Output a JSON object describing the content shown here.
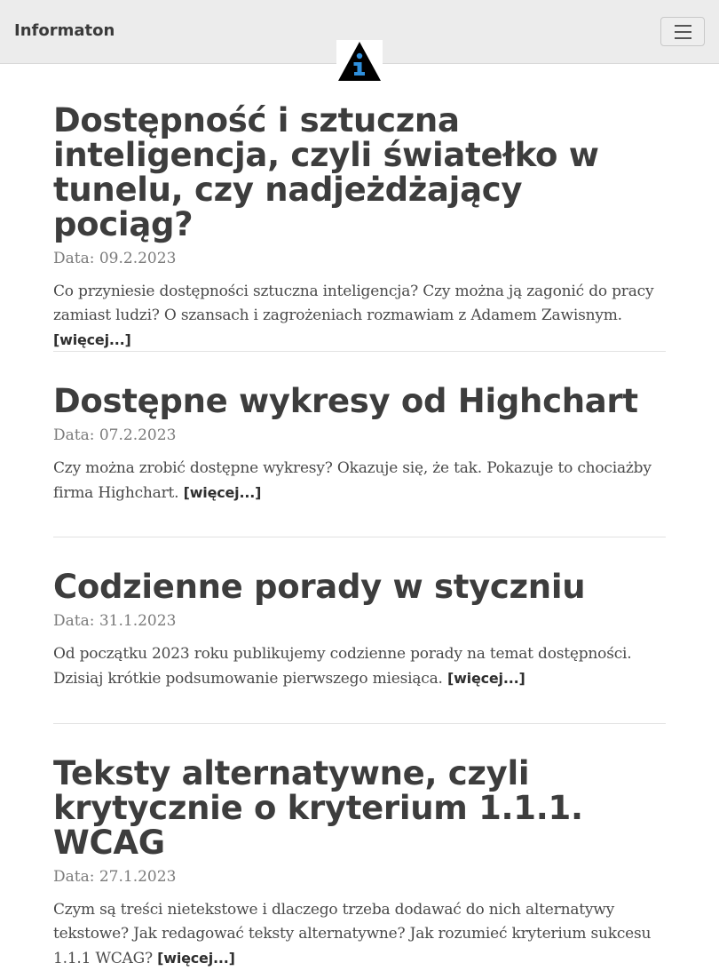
{
  "navbar": {
    "brand": "Informaton",
    "toggler_icon": "hamburger-icon",
    "logo_icon": "information-warning-triangle-icon"
  },
  "articles": [
    {
      "title": "Dostępność i sztuczna inteligencja, czyli światełko w tunelu, czy nadjeżdżający pociąg?",
      "date": "Data: 09.2.2023",
      "excerpt": "Co przyniesie dostępności sztuczna inteligencja? Czy można ją zagonić do pracy zamiast ludzi? O szansach i zagrożeniach rozmawiam z Adamem Zawisnym.",
      "more": "[więcej...]"
    },
    {
      "title": "Dostępne wykresy od Highchart",
      "date": "Data: 07.2.2023",
      "excerpt": "Czy można zrobić dostępne wykresy? Okazuje się, że tak. Pokazuje to chociażby firma Highchart.",
      "more": "[więcej...]"
    },
    {
      "title": "Codzienne porady w styczniu",
      "date": "Data: 31.1.2023",
      "excerpt": "Od początku 2023 roku publikujemy codzienne porady na temat dostępności. Dzisiaj krótkie podsumowanie pierwszego miesiąca.",
      "more": "[więcej...]"
    },
    {
      "title": "Teksty alternatywne, czyli krytycznie o kryterium 1.1.1. WCAG",
      "date": "Data: 27.1.2023",
      "excerpt": "Czym są treści nietekstowe i dlaczego trzeba dodawać do nich alternatywy tekstowe? Jak redagować teksty alternatywne? Jak rozumieć kryterium sukcesu 1.1.1 WCAG?",
      "more": "[więcej...]"
    }
  ],
  "colors": {
    "navbar_bg": "#ececec",
    "logo_triangle": "#000000",
    "logo_i": "#2f8fdc"
  }
}
